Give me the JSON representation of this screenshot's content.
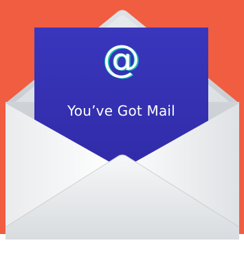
{
  "card": {
    "symbol": "@",
    "headline": "You’ve Got Mail"
  },
  "colors": {
    "background": "#f05d40",
    "card": "#3631b4",
    "accent": "#19c3b8",
    "envelope": "#e6e8ea"
  },
  "icons": {
    "main": "open-envelope-icon"
  }
}
